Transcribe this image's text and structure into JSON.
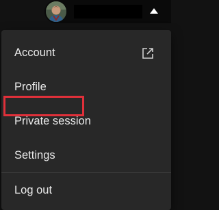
{
  "menu": {
    "items": [
      {
        "label": "Account",
        "icon": "external-link-icon"
      },
      {
        "label": "Profile"
      },
      {
        "label": "Private session"
      },
      {
        "label": "Settings",
        "highlighted": true
      },
      {
        "label": "Log out"
      }
    ]
  },
  "header": {
    "avatar_icon": "user-avatar",
    "caret_icon": "caret-up-icon"
  },
  "colors": {
    "background": "#121212",
    "menu_background": "#282828",
    "text": "#eaeaea",
    "highlight": "#e0303a"
  }
}
